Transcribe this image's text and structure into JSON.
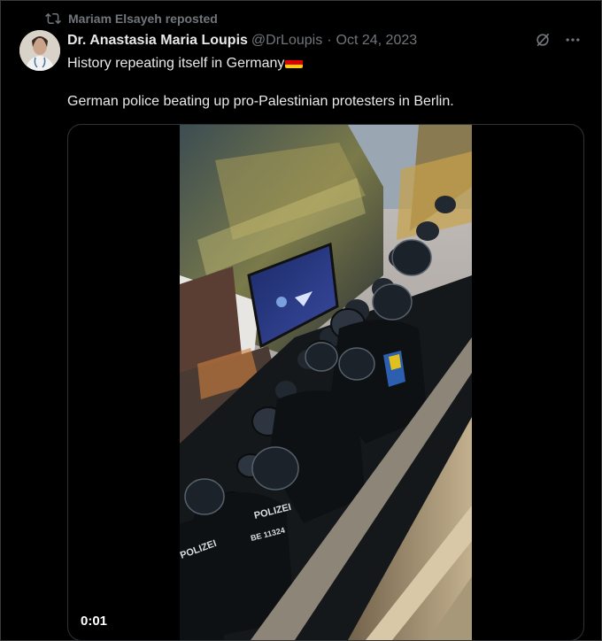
{
  "repost": {
    "text": "Mariam Elsayeh reposted",
    "icon": "repost-icon"
  },
  "tweet": {
    "author_name": "Dr. Anastasia Maria Loupis",
    "handle": "@DrLoupis",
    "separator": "·",
    "date": "Oct 24, 2023",
    "text_line1": "History repeating itself in Germany",
    "flag_emoji": "german-flag-icon",
    "text_line2": "German police beating up pro-Palestinian protesters in Berlin.",
    "actions": [
      "grok-icon",
      "more-icon"
    ]
  },
  "video": {
    "timestamp": "0:01",
    "uniform_text_1": "POLIZEI",
    "uniform_text_2": "BE 11324",
    "uniform_text_3": "POLIZEI"
  },
  "colors": {
    "background": "#000000",
    "text_primary": "#e7e9ea",
    "text_secondary": "#71767b",
    "border": "#2f3336"
  }
}
